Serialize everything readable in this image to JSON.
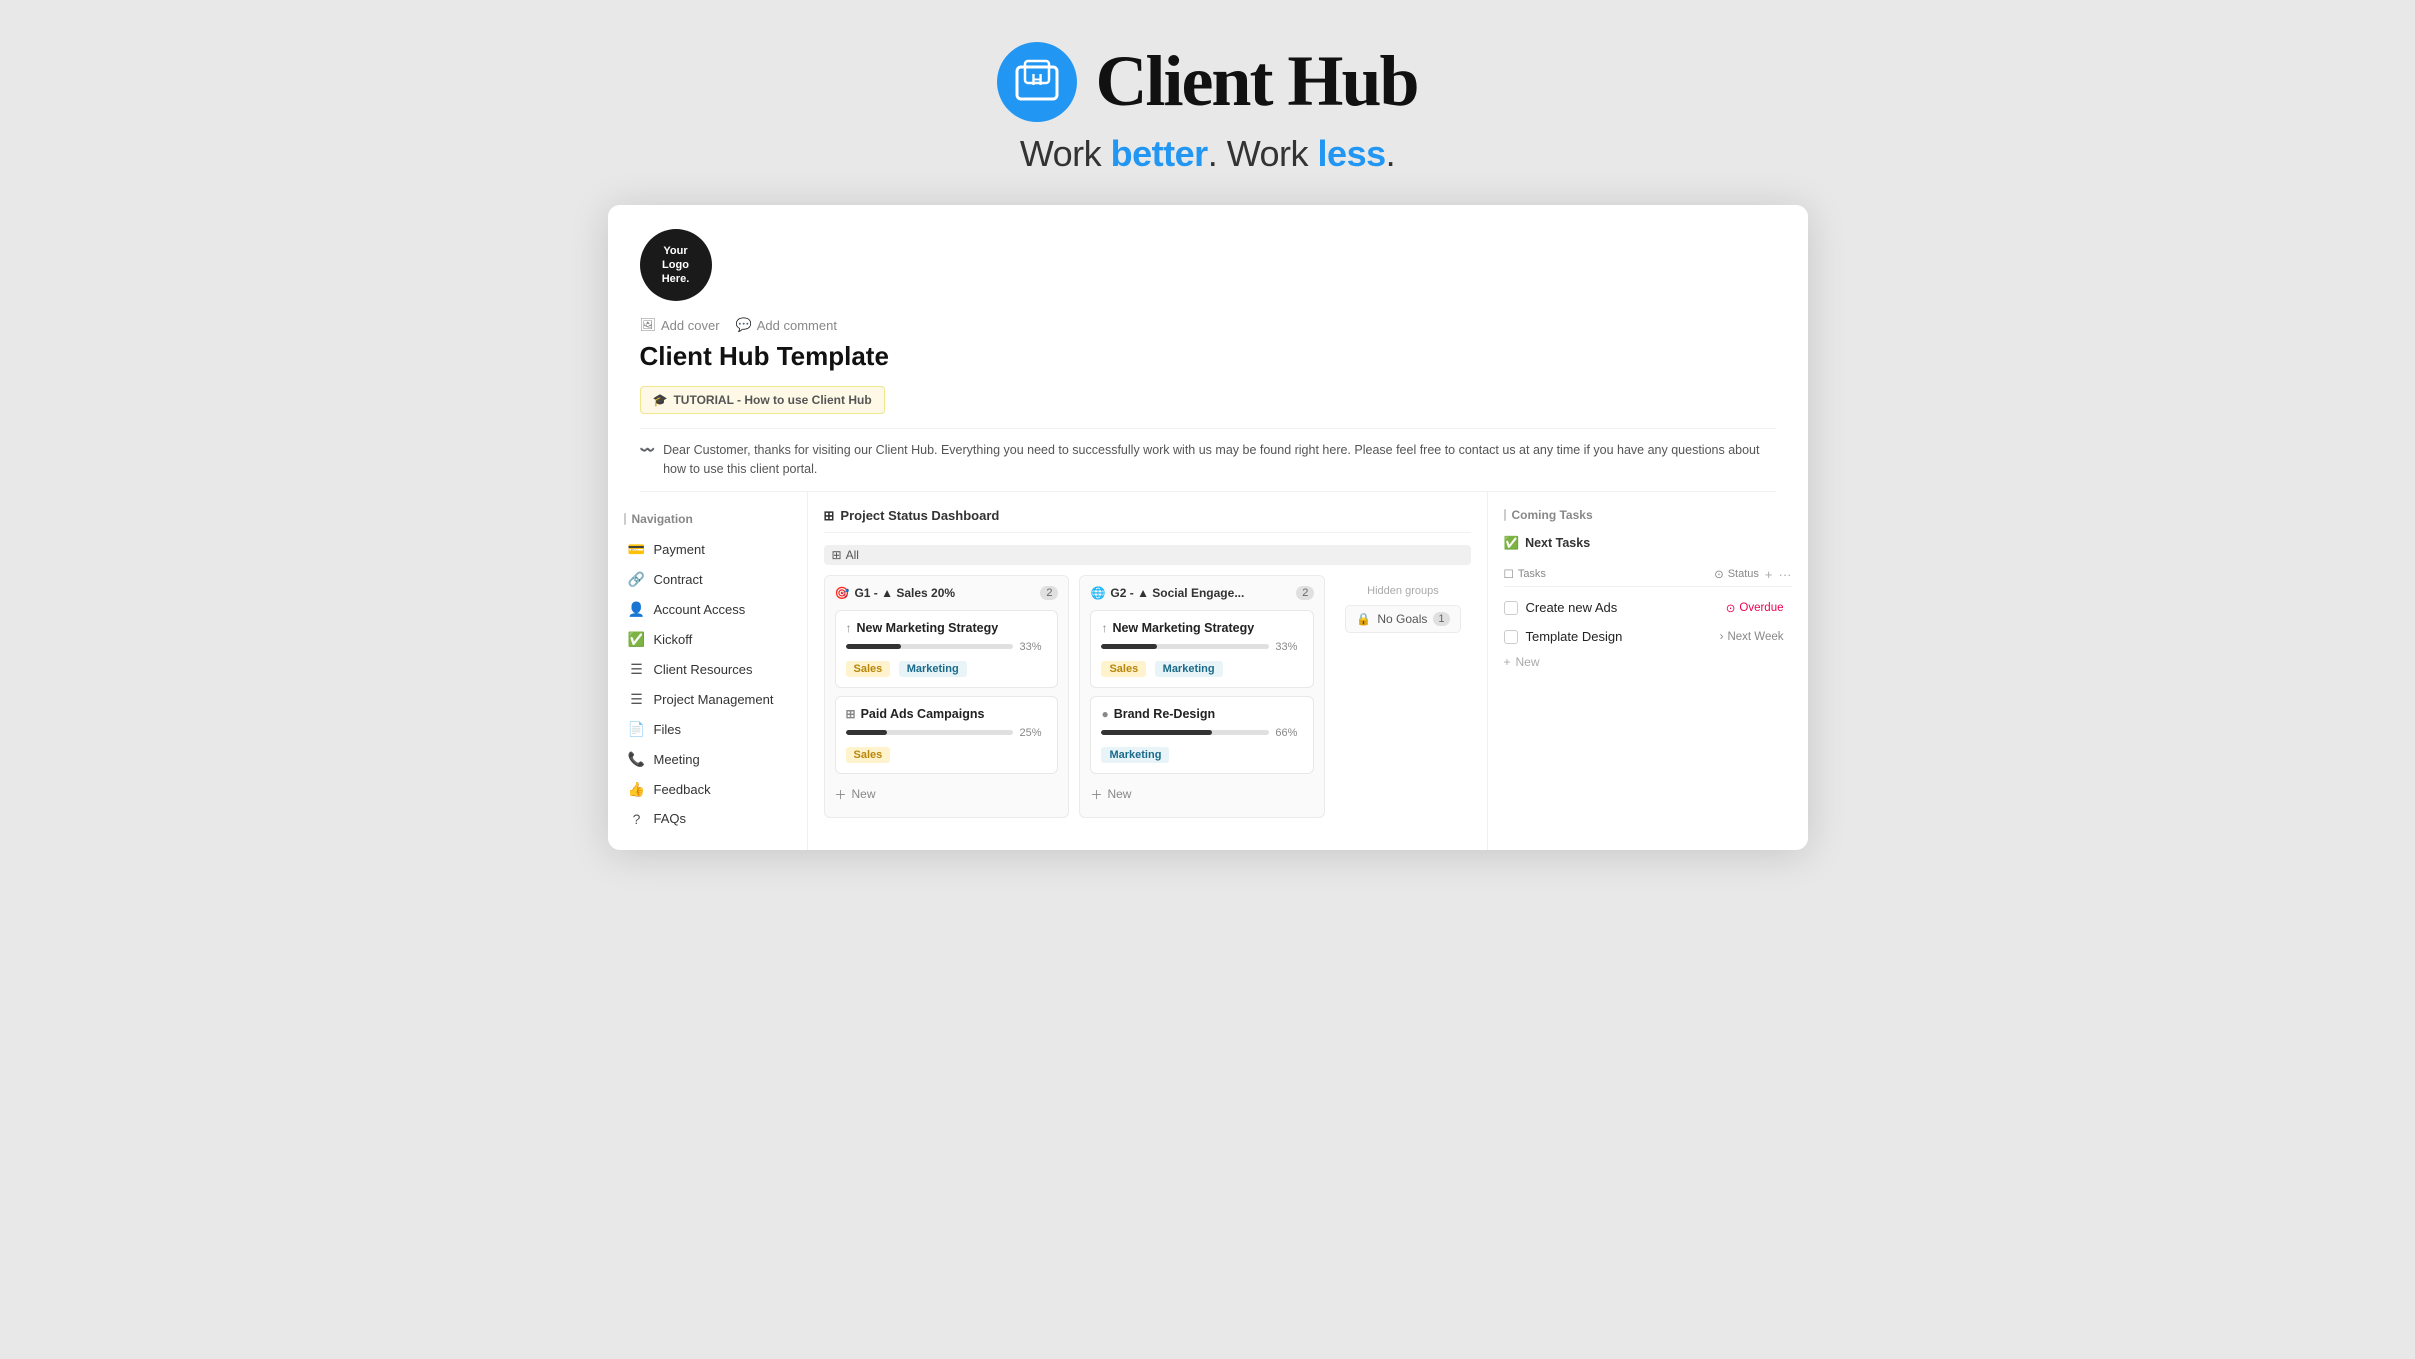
{
  "branding": {
    "title": "Client Hub",
    "tagline_start": "Work ",
    "tagline_better": "better",
    "tagline_middle": ". Work ",
    "tagline_less": "less",
    "tagline_end": "."
  },
  "logo_placeholder": {
    "line1": "Your",
    "line2": "Logo",
    "line3": "Here."
  },
  "app_header": {
    "add_cover": "Add cover",
    "add_comment": "Add comment",
    "title": "Client Hub Template",
    "tutorial_label": "TUTORIAL - How to use Client Hub",
    "welcome_message": "Dear Customer, thanks for visiting our Client Hub. Everything you need to successfully work with us may be found right here. Please feel free to contact us at any time if you have any questions about how to use this client portal."
  },
  "sidebar": {
    "heading": "Navigation",
    "items": [
      {
        "id": "payment",
        "label": "Payment",
        "icon": "💳"
      },
      {
        "id": "contract",
        "label": "Contract",
        "icon": "🔗"
      },
      {
        "id": "account-access",
        "label": "Account Access",
        "icon": "👤"
      },
      {
        "id": "kickoff",
        "label": "Kickoff",
        "icon": "✅"
      },
      {
        "id": "client-resources",
        "label": "Client Resources",
        "icon": "☰"
      },
      {
        "id": "project-management",
        "label": "Project Management",
        "icon": "☰"
      },
      {
        "id": "files",
        "label": "Files",
        "icon": "📄"
      },
      {
        "id": "meeting",
        "label": "Meeting",
        "icon": "📞"
      },
      {
        "id": "feedback",
        "label": "Feedback",
        "icon": "👍"
      },
      {
        "id": "faqs",
        "label": "FAQs",
        "icon": "?"
      }
    ]
  },
  "dashboard": {
    "title": "Project Status Dashboard",
    "view_all": "All",
    "columns": [
      {
        "id": "g1",
        "title": "G1 - ▲ Sales 20%",
        "count": 2,
        "icon": "🎯",
        "cards": [
          {
            "title": "New Marketing Strategy",
            "icon": "↑",
            "progress": 33,
            "tags": [
              "Sales",
              "Marketing"
            ]
          },
          {
            "title": "Paid Ads Campaigns",
            "icon": "⊞",
            "progress": 25,
            "tags": [
              "Sales"
            ]
          }
        ],
        "add_label": "New"
      },
      {
        "id": "g2",
        "title": "G2 - ▲ Social Engage...",
        "count": 2,
        "icon": "🌐",
        "cards": [
          {
            "title": "New Marketing Strategy",
            "icon": "↑",
            "progress": 33,
            "tags": [
              "Sales",
              "Marketing"
            ]
          },
          {
            "title": "Brand Re-Design",
            "icon": "●",
            "progress": 66,
            "tags": [
              "Marketing"
            ]
          }
        ],
        "add_label": "New"
      }
    ],
    "hidden_groups_label": "Hidden groups",
    "no_goals": {
      "label": "No Goals",
      "count": 1,
      "icon": "🔒"
    }
  },
  "coming_tasks": {
    "heading": "Coming Tasks",
    "tab_label": "Next Tasks",
    "tab_icon": "✅",
    "col_tasks": "Tasks",
    "col_status": "Status",
    "tasks": [
      {
        "name": "Create new Ads",
        "status": "Overdue",
        "status_type": "overdue"
      },
      {
        "name": "Template Design",
        "status": "Next Week",
        "status_type": "next-week"
      }
    ],
    "new_label": "New"
  },
  "colors": {
    "brand_blue": "#2196F3",
    "accent_black": "#1a1a1a",
    "tag_sales_bg": "#fff3cd",
    "tag_sales_text": "#b8860b",
    "tag_marketing_bg": "#e8f4f8",
    "tag_marketing_text": "#1a6a8a"
  }
}
